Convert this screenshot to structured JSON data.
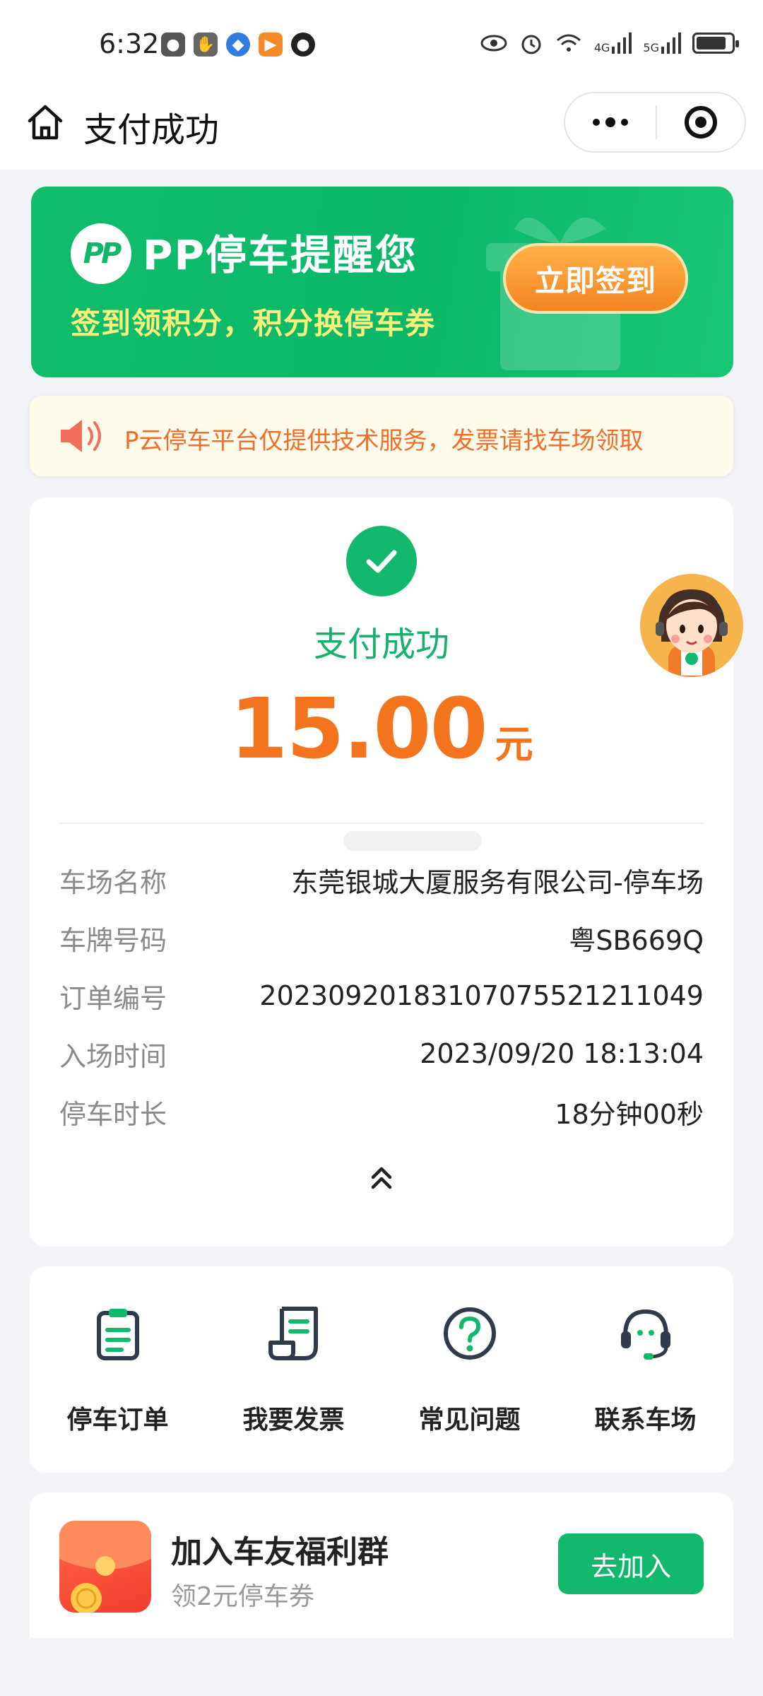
{
  "status_bar": {
    "time": "6:32",
    "network_1": "4G",
    "network_2": "5G",
    "battery_level": 0.85
  },
  "nav": {
    "title": "支付成功",
    "home_icon": "home-icon",
    "more_icon": "more-dots-icon",
    "close_icon": "target-close-icon"
  },
  "banner": {
    "logo_text": "PP",
    "title": "PP停车提醒您",
    "subtitle": "签到领积分，积分换停车券",
    "button_label": "立即签到"
  },
  "notice": {
    "icon": "speaker-icon",
    "text": "P云停车平台仅提供技术服务，发票请找车场领取"
  },
  "payment": {
    "status": "支付成功",
    "amount": "15.00",
    "unit": "元",
    "details": [
      {
        "label": "车场名称",
        "value": "东莞银城大厦服务有限公司-停车场"
      },
      {
        "label": "车牌号码",
        "value": "粤SB669Q"
      },
      {
        "label": "订单编号",
        "value": "20230920183107075521211049"
      },
      {
        "label": "入场时间",
        "value": "2023/09/20 18:13:04"
      },
      {
        "label": "停车时长",
        "value": "18分钟00秒"
      }
    ]
  },
  "actions": [
    {
      "label": "停车订单",
      "icon": "clipboard-icon"
    },
    {
      "label": "我要发票",
      "icon": "invoice-icon"
    },
    {
      "label": "常见问题",
      "icon": "question-icon"
    },
    {
      "label": "联系车场",
      "icon": "headset-icon"
    }
  ],
  "group": {
    "title": "加入车友福利群",
    "subtitle": "领2元停车券",
    "button_label": "去加入"
  },
  "colors": {
    "brand_green": "#12b86c",
    "amount_orange": "#f3741c",
    "notice_orange": "#f06e2a"
  }
}
